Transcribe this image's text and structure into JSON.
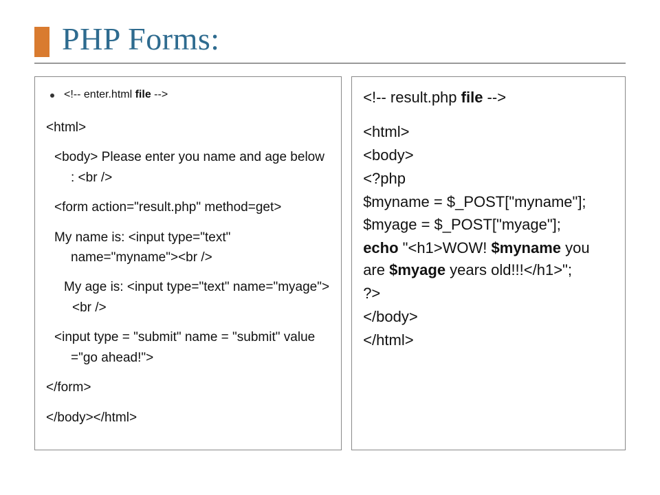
{
  "title": "PHP Forms:",
  "left": {
    "bullet": "<!-- enter.html file -->",
    "l1": "<html>",
    "l2": "<body>   Please enter you name and age below : <br />",
    "l3": "<form action=\"result.php\" method=get>",
    "l4": "My name is:  <input type=\"text\" name=\"myname\"><br />",
    "l5": " My age is:  <input type=\"text\" name=\"myage\"><br />",
    "l6": "<input type = \"submit\" name = \"submit\" value =\"go ahead!\">",
    "l7": "</form>",
    "l8": "</body></html>"
  },
  "right": {
    "r0a": "<!-- result.php ",
    "r0b": "file",
    "r0c": " -->",
    "r1": "<html>",
    "r2": "<body>",
    "r3": "<?php",
    "r4": "$myname = $_POST[\"myname\"];",
    "r5": "$myage = $_POST[\"myage\"];",
    "r6a": "echo",
    "r6b": " \"<h1>WOW! ",
    "r6c": "$myname",
    "r6d": " you are ",
    "r6e": "$myage",
    "r6f": " years old!!!</h1>\";",
    "r7": "?>",
    "r8": "</body>",
    "r9": "</html>"
  }
}
